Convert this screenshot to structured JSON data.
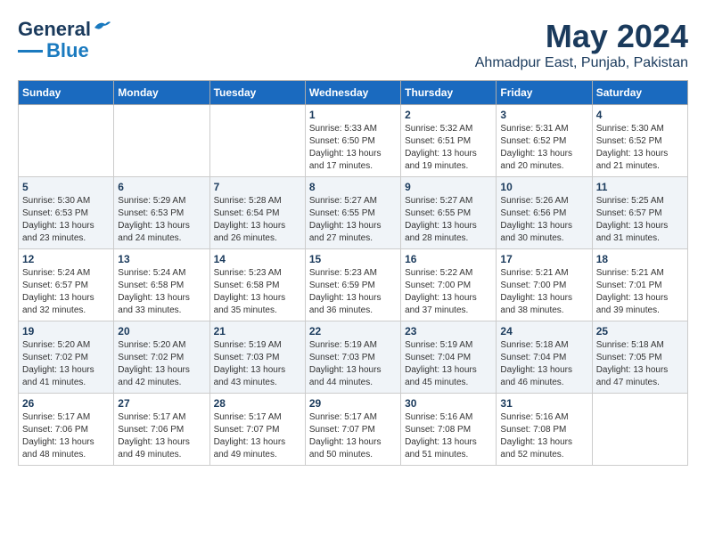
{
  "logo": {
    "line1": "General",
    "line2": "Blue"
  },
  "title": "May 2024",
  "subtitle": "Ahmadpur East, Punjab, Pakistan",
  "days_of_week": [
    "Sunday",
    "Monday",
    "Tuesday",
    "Wednesday",
    "Thursday",
    "Friday",
    "Saturday"
  ],
  "weeks": [
    [
      {
        "day": "",
        "info": ""
      },
      {
        "day": "",
        "info": ""
      },
      {
        "day": "",
        "info": ""
      },
      {
        "day": "1",
        "info": "Sunrise: 5:33 AM\nSunset: 6:50 PM\nDaylight: 13 hours\nand 17 minutes."
      },
      {
        "day": "2",
        "info": "Sunrise: 5:32 AM\nSunset: 6:51 PM\nDaylight: 13 hours\nand 19 minutes."
      },
      {
        "day": "3",
        "info": "Sunrise: 5:31 AM\nSunset: 6:52 PM\nDaylight: 13 hours\nand 20 minutes."
      },
      {
        "day": "4",
        "info": "Sunrise: 5:30 AM\nSunset: 6:52 PM\nDaylight: 13 hours\nand 21 minutes."
      }
    ],
    [
      {
        "day": "5",
        "info": "Sunrise: 5:30 AM\nSunset: 6:53 PM\nDaylight: 13 hours\nand 23 minutes."
      },
      {
        "day": "6",
        "info": "Sunrise: 5:29 AM\nSunset: 6:53 PM\nDaylight: 13 hours\nand 24 minutes."
      },
      {
        "day": "7",
        "info": "Sunrise: 5:28 AM\nSunset: 6:54 PM\nDaylight: 13 hours\nand 26 minutes."
      },
      {
        "day": "8",
        "info": "Sunrise: 5:27 AM\nSunset: 6:55 PM\nDaylight: 13 hours\nand 27 minutes."
      },
      {
        "day": "9",
        "info": "Sunrise: 5:27 AM\nSunset: 6:55 PM\nDaylight: 13 hours\nand 28 minutes."
      },
      {
        "day": "10",
        "info": "Sunrise: 5:26 AM\nSunset: 6:56 PM\nDaylight: 13 hours\nand 30 minutes."
      },
      {
        "day": "11",
        "info": "Sunrise: 5:25 AM\nSunset: 6:57 PM\nDaylight: 13 hours\nand 31 minutes."
      }
    ],
    [
      {
        "day": "12",
        "info": "Sunrise: 5:24 AM\nSunset: 6:57 PM\nDaylight: 13 hours\nand 32 minutes."
      },
      {
        "day": "13",
        "info": "Sunrise: 5:24 AM\nSunset: 6:58 PM\nDaylight: 13 hours\nand 33 minutes."
      },
      {
        "day": "14",
        "info": "Sunrise: 5:23 AM\nSunset: 6:58 PM\nDaylight: 13 hours\nand 35 minutes."
      },
      {
        "day": "15",
        "info": "Sunrise: 5:23 AM\nSunset: 6:59 PM\nDaylight: 13 hours\nand 36 minutes."
      },
      {
        "day": "16",
        "info": "Sunrise: 5:22 AM\nSunset: 7:00 PM\nDaylight: 13 hours\nand 37 minutes."
      },
      {
        "day": "17",
        "info": "Sunrise: 5:21 AM\nSunset: 7:00 PM\nDaylight: 13 hours\nand 38 minutes."
      },
      {
        "day": "18",
        "info": "Sunrise: 5:21 AM\nSunset: 7:01 PM\nDaylight: 13 hours\nand 39 minutes."
      }
    ],
    [
      {
        "day": "19",
        "info": "Sunrise: 5:20 AM\nSunset: 7:02 PM\nDaylight: 13 hours\nand 41 minutes."
      },
      {
        "day": "20",
        "info": "Sunrise: 5:20 AM\nSunset: 7:02 PM\nDaylight: 13 hours\nand 42 minutes."
      },
      {
        "day": "21",
        "info": "Sunrise: 5:19 AM\nSunset: 7:03 PM\nDaylight: 13 hours\nand 43 minutes."
      },
      {
        "day": "22",
        "info": "Sunrise: 5:19 AM\nSunset: 7:03 PM\nDaylight: 13 hours\nand 44 minutes."
      },
      {
        "day": "23",
        "info": "Sunrise: 5:19 AM\nSunset: 7:04 PM\nDaylight: 13 hours\nand 45 minutes."
      },
      {
        "day": "24",
        "info": "Sunrise: 5:18 AM\nSunset: 7:04 PM\nDaylight: 13 hours\nand 46 minutes."
      },
      {
        "day": "25",
        "info": "Sunrise: 5:18 AM\nSunset: 7:05 PM\nDaylight: 13 hours\nand 47 minutes."
      }
    ],
    [
      {
        "day": "26",
        "info": "Sunrise: 5:17 AM\nSunset: 7:06 PM\nDaylight: 13 hours\nand 48 minutes."
      },
      {
        "day": "27",
        "info": "Sunrise: 5:17 AM\nSunset: 7:06 PM\nDaylight: 13 hours\nand 49 minutes."
      },
      {
        "day": "28",
        "info": "Sunrise: 5:17 AM\nSunset: 7:07 PM\nDaylight: 13 hours\nand 49 minutes."
      },
      {
        "day": "29",
        "info": "Sunrise: 5:17 AM\nSunset: 7:07 PM\nDaylight: 13 hours\nand 50 minutes."
      },
      {
        "day": "30",
        "info": "Sunrise: 5:16 AM\nSunset: 7:08 PM\nDaylight: 13 hours\nand 51 minutes."
      },
      {
        "day": "31",
        "info": "Sunrise: 5:16 AM\nSunset: 7:08 PM\nDaylight: 13 hours\nand 52 minutes."
      },
      {
        "day": "",
        "info": ""
      }
    ]
  ]
}
